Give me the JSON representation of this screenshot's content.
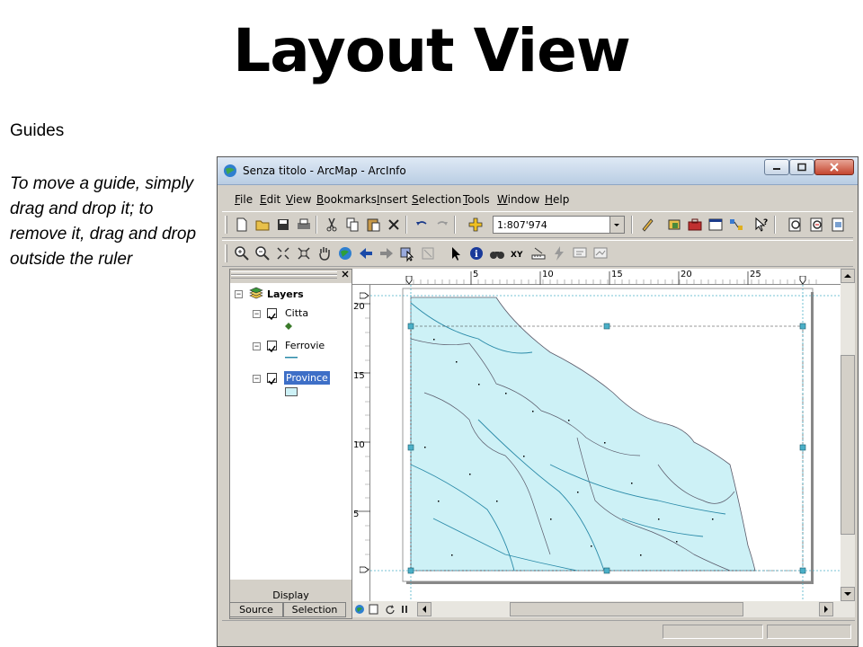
{
  "slide": {
    "title": "Layout View",
    "subtitle": "Guides",
    "body": "To move a guide, simply drag and drop it; to remove it, drag and drop outside the ruler"
  },
  "window": {
    "title": "Senza titolo - ArcMap - ArcInfo",
    "menu": [
      "File",
      "Edit",
      "View",
      "Bookmarks",
      "Insert",
      "Selection",
      "Tools",
      "Window",
      "Help"
    ],
    "scale": "1:807'974"
  },
  "toc": {
    "root": "Layers",
    "layers": [
      {
        "name": "Citta",
        "checked": true,
        "symbol": "point"
      },
      {
        "name": "Ferrovie",
        "checked": true,
        "symbol": "line"
      },
      {
        "name": "Province",
        "checked": true,
        "symbol": "polygon",
        "selected": true
      }
    ],
    "display_label": "Display",
    "tabs": [
      "Source",
      "Selection"
    ]
  },
  "ruler": {
    "horizontal": [
      "5",
      "10",
      "15",
      "20",
      "25"
    ],
    "vertical": [
      "20",
      "15",
      "10",
      "5"
    ]
  },
  "colors": {
    "map_fill": "#cdf1f6",
    "river": "#2a8aa8",
    "boundary": "#5a5a6a",
    "selected": "#3e6fc7",
    "guide": "#4bb0c8"
  }
}
